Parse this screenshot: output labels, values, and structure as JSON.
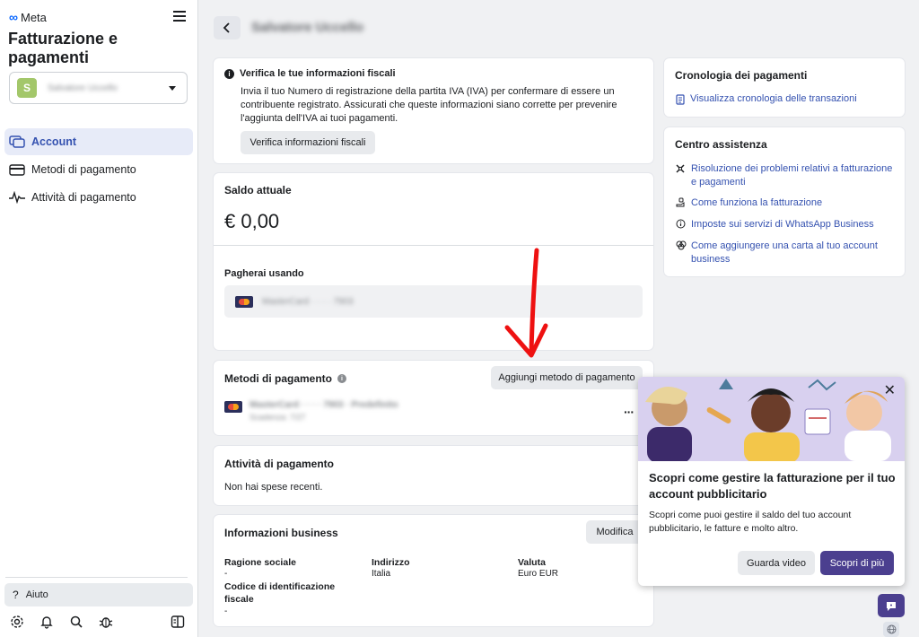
{
  "sidebar": {
    "logo": "Meta",
    "title": "Fatturazione e pagamenti",
    "account_initial": "S",
    "account_name": "Salvatore Uccello",
    "nav": [
      {
        "label": "Account",
        "icon": "account-icon",
        "active": true
      },
      {
        "label": "Metodi di pagamento",
        "icon": "credit-card-icon",
        "active": false
      },
      {
        "label": "Attività di pagamento",
        "icon": "activity-icon",
        "active": false
      }
    ],
    "help_label": "Aiuto",
    "bottom_icons": [
      "gear-icon",
      "bell-icon",
      "search-icon",
      "bug-icon",
      "panel-toggle-icon"
    ]
  },
  "header": {
    "name": "Salvatore Uccello"
  },
  "tax_card": {
    "title": "Verifica le tue informazioni fiscali",
    "body": "Invia il tuo Numero di registrazione della partita IVA (IVA) per confermare di essere un contribuente registrato. Assicurati che queste informazioni siano corrette per prevenire l'aggiunta dell'IVA ai tuoi pagamenti.",
    "button": "Verifica informazioni fiscali"
  },
  "balance_card": {
    "title": "Saldo attuale",
    "amount": "€ 0,00",
    "pay_using_label": "Pagherai usando",
    "card_masked": "MasterCard · · · · 7903"
  },
  "methods_card": {
    "title": "Metodi di pagamento",
    "add_button": "Aggiungi metodo di pagamento",
    "card_line": "MasterCard · · · · 7903 · Predefinito",
    "card_expiry": "Scadenza: 7/27",
    "more": "···"
  },
  "activity_card": {
    "title": "Attività di pagamento",
    "empty": "Non hai spese recenti."
  },
  "business_card": {
    "title": "Informazioni business",
    "edit_button": "Modifica",
    "company_label": "Ragione sociale",
    "company_value": "-",
    "address_label": "Indirizzo",
    "address_value": "Italia",
    "currency_label": "Valuta",
    "currency_value": "Euro EUR",
    "tax_id_label": "Codice di identificazione fiscale",
    "tax_id_value": "-"
  },
  "history_card": {
    "title": "Cronologia dei pagamenti",
    "link": "Visualizza cronologia delle transazioni"
  },
  "help_center": {
    "title": "Centro assistenza",
    "links": [
      {
        "label": "Risoluzione dei problemi relativi a fatturazione e pagamenti",
        "icon": "tools-icon"
      },
      {
        "label": "Come funziona la fatturazione",
        "icon": "billing-hand-icon"
      },
      {
        "label": "Imposte sui servizi di WhatsApp Business",
        "icon": "info-circle-icon"
      },
      {
        "label": "Come aggiungere una carta al tuo account business",
        "icon": "cards-icon"
      }
    ]
  },
  "popup": {
    "title": "Scopri come gestire la fatturazione per il tuo account pubblicitario",
    "description": "Scopri come puoi gestire il saldo del tuo account pubblicitario, le fatture e molto altro.",
    "video_button": "Guarda video",
    "more_button": "Scopri di più"
  },
  "colors": {
    "accent": "#3552b0",
    "purple": "#4b3f8f",
    "arrow": "#ee1111"
  }
}
